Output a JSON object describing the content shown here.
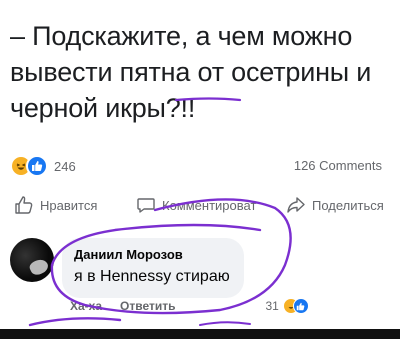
{
  "post": {
    "lines": [
      "– Подскажите, а чем можно",
      "вывести пятна от осетрины и",
      "черной икры?!!"
    ]
  },
  "stats": {
    "reactions_count": "246",
    "comments_count": "126 Comments",
    "reaction_icons": [
      "haha-emoji-icon",
      "like-thumb-icon"
    ]
  },
  "actions": {
    "like_label": "Нравится",
    "comment_label": "Комментироват",
    "share_label": "Поделиться"
  },
  "comment": {
    "author": "Даниил Морозов",
    "text": "я в Hennessy стираю",
    "haha_label": "Ха-ха",
    "reply_label": "Ответить",
    "reactions_count": "31"
  },
  "colors": {
    "ink": "#7b2fd0",
    "like_blue": "#1877f2",
    "haha_yellow": "#f7b125",
    "muted_text": "#65676b",
    "bubble_bg": "#f0f2f5"
  }
}
